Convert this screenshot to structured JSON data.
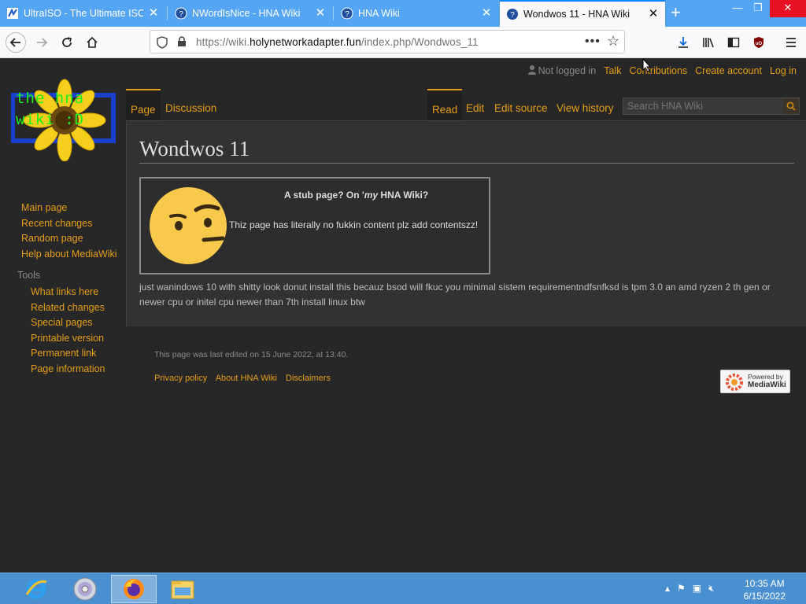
{
  "browser": {
    "tabs": [
      {
        "title": "UltraISO - The Ultimate ISO F",
        "icon": "ultraiso-icon"
      },
      {
        "title": "NWordIsNice - HNA Wiki",
        "icon": "help-circle-icon"
      },
      {
        "title": "HNA Wiki",
        "icon": "help-circle-icon"
      },
      {
        "title": "Wondwos 11 - HNA Wiki",
        "icon": "help-circle-icon"
      }
    ],
    "url": {
      "prefix": "https://wiki.",
      "domain": "holynetworkadapter.fun",
      "path": "/index.php/Wondwos_11"
    }
  },
  "wiki": {
    "logo_text": "the hna wiki :D",
    "personal": {
      "status": "Not logged in",
      "talk": "Talk",
      "contributions": "Contributions",
      "create_account": "Create account",
      "login": "Log in"
    },
    "tabs": {
      "page": "Page",
      "discussion": "Discussion",
      "read": "Read",
      "edit": "Edit",
      "edit_source": "Edit source",
      "view_history": "View history"
    },
    "search_placeholder": "Search HNA Wiki",
    "title": "Wondwos 11",
    "stub": {
      "title_a": "A stub page? On '",
      "title_b": "my",
      "title_c": " HNA Wiki?",
      "text": "Thiz page has literally no fukkin content plz add contentszz!"
    },
    "body": "just wanindows 10 with shitty look donut install this becauz bsod will fkuc you minimal sistem requirementndfsnfksd is tpm 3.0 an amd ryzen 2 th gen or newer cpu or initel cpu newer than 7th install linux btw",
    "nav": [
      "Main page",
      "Recent changes",
      "Random page",
      "Help about MediaWiki"
    ],
    "tools_heading": "Tools",
    "tools": [
      "What links here",
      "Related changes",
      "Special pages",
      "Printable version",
      "Permanent link",
      "Page information"
    ],
    "last_edited": "This page was last edited on 15 June 2022, at 13:40.",
    "footer_links": [
      "Privacy policy",
      "About HNA Wiki",
      "Disclaimers"
    ],
    "powered_top": "Powered by",
    "powered_bottom": "MediaWiki"
  },
  "taskbar": {
    "time": "10:35 AM",
    "date": "6/15/2022"
  },
  "colors": {
    "link": "#e59e17",
    "tabbar": "#55a5f5",
    "taskbar": "#4a90d0",
    "page_bg": "#272727"
  }
}
